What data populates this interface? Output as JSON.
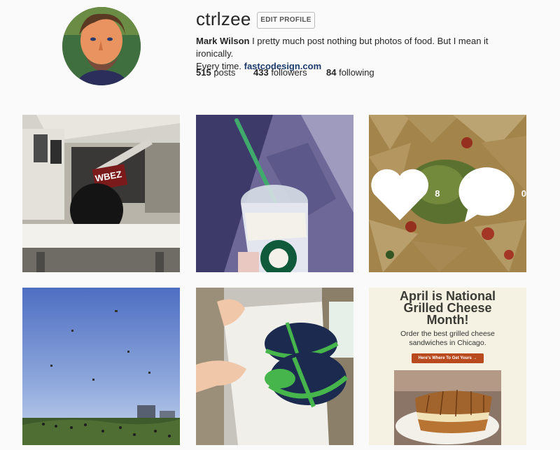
{
  "profile": {
    "username": "ctrlzee",
    "edit_label": "EDIT PROFILE",
    "full_name": "Mark Wilson",
    "bio_line1": " I pretty much post nothing but photos of food. But I mean it ironically.",
    "bio_line2": "Every time. ",
    "website": "fastcodesign.com"
  },
  "stats": {
    "posts_count": "515",
    "posts_label": " posts",
    "followers_count": "433",
    "followers_label": " followers",
    "following_count": "84",
    "following_label": " following"
  },
  "posts": [
    {
      "name": "radio-studio-photo",
      "icon": "wbez-radio-studio"
    },
    {
      "name": "starbucks-drink-photo",
      "icon": "starbucks-cup"
    },
    {
      "name": "nachos-photo",
      "icon": "nachos-food",
      "likes": "8",
      "comments": "0"
    },
    {
      "name": "kites-park-photo",
      "icon": "kite-field"
    },
    {
      "name": "baby-shoes-photo",
      "icon": "baby-shoes"
    },
    {
      "name": "grilled-cheese-ad",
      "icon": "grilled-cheese"
    }
  ],
  "ad": {
    "title_line1": "April is National",
    "title_line2": "Grilled Cheese",
    "title_line3": "Month!",
    "sub_line1": "Order the best grilled cheese",
    "sub_line2": "sandwiches in Chicago.",
    "button": "Here's Where To Get Yours  →"
  },
  "colors": {
    "link": "#1c3b6b",
    "background": "#fafafa",
    "ad_button": "#b84a1e"
  }
}
